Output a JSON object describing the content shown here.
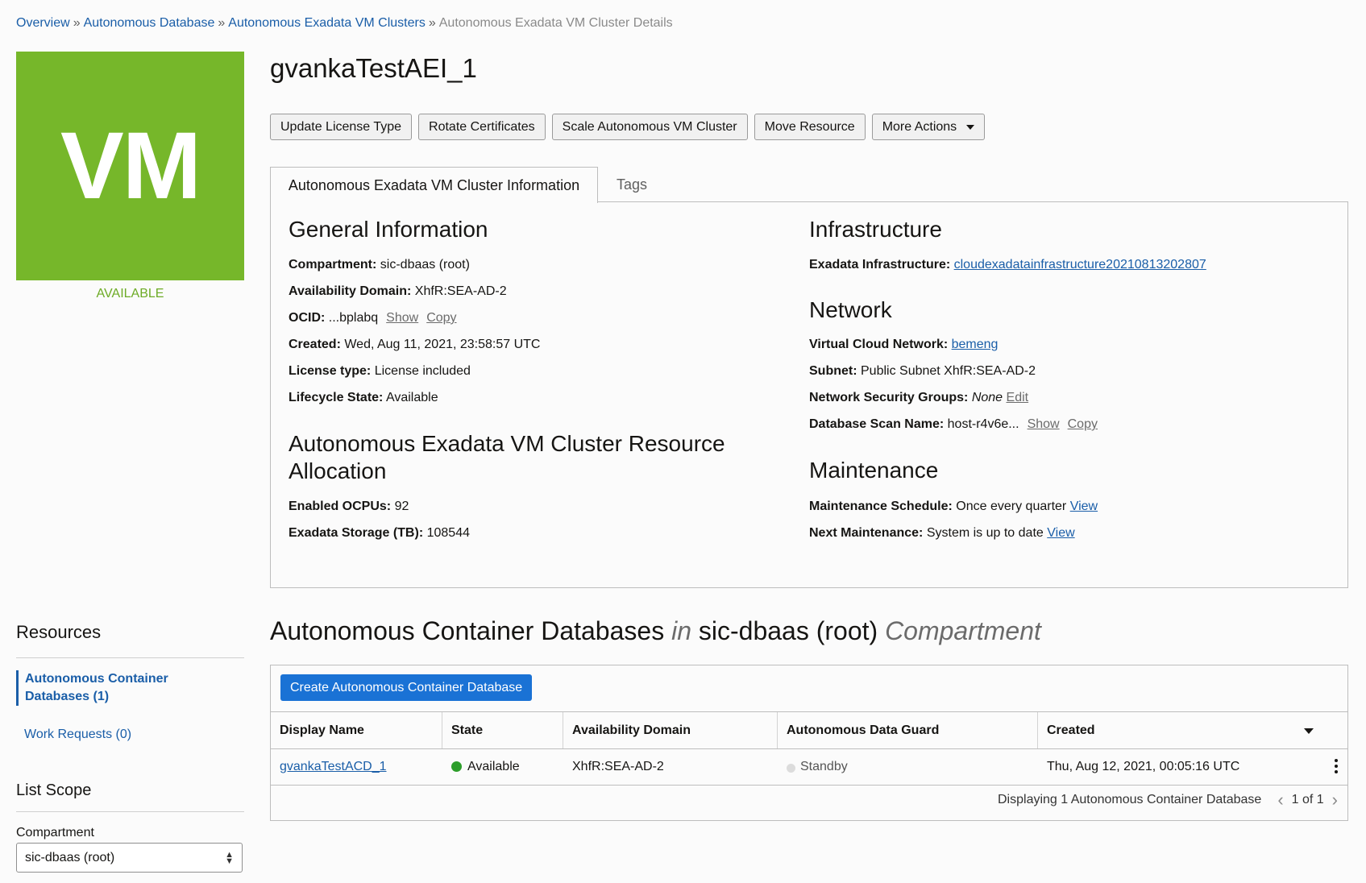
{
  "breadcrumb": {
    "items": [
      "Overview",
      "Autonomous Database",
      "Autonomous Exadata VM Clusters"
    ],
    "separator": "»",
    "current": "Autonomous Exadata VM Cluster Details"
  },
  "resource": {
    "icon_text": "VM",
    "status": "AVAILABLE",
    "title": "gvankaTestAEI_1"
  },
  "actions": {
    "update_license": "Update License Type",
    "rotate_certs": "Rotate Certificates",
    "scale": "Scale Autonomous VM Cluster",
    "move": "Move Resource",
    "more": "More Actions"
  },
  "tabs": {
    "info": "Autonomous Exadata VM Cluster Information",
    "tags": "Tags"
  },
  "general": {
    "heading": "General Information",
    "compartment_label": "Compartment:",
    "compartment": "sic-dbaas (root)",
    "ad_label": "Availability Domain:",
    "ad": "XhfR:SEA-AD-2",
    "ocid_label": "OCID:",
    "ocid": "...bplabq",
    "show": "Show",
    "copy": "Copy",
    "created_label": "Created:",
    "created": "Wed, Aug 11, 2021, 23:58:57 UTC",
    "license_label": "License type:",
    "license": "License included",
    "lifecycle_label": "Lifecycle State:",
    "lifecycle": "Available"
  },
  "allocation": {
    "heading_line1": "Autonomous Exadata VM Cluster Resource",
    "heading_line2": "Allocation",
    "ocpus_label": "Enabled OCPUs:",
    "ocpus": "92",
    "storage_label": "Exadata Storage (TB):",
    "storage": "108544"
  },
  "infrastructure": {
    "heading": "Infrastructure",
    "exa_label": "Exadata Infrastructure:",
    "exa": "cloudexadatainfrastructure20210813202807"
  },
  "network": {
    "heading": "Network",
    "vcn_label": "Virtual Cloud Network:",
    "vcn": "bemeng",
    "subnet_label": "Subnet:",
    "subnet": "Public Subnet XhfR:SEA-AD-2",
    "nsg_label": "Network Security Groups:",
    "nsg": "None",
    "edit": "Edit",
    "scan_label": "Database Scan Name:",
    "scan": "host-r4v6e...",
    "show": "Show",
    "copy": "Copy"
  },
  "maintenance": {
    "heading": "Maintenance",
    "schedule_label": "Maintenance Schedule:",
    "schedule": "Once every quarter",
    "view": "View",
    "next_label": "Next Maintenance:",
    "next": "System is up to date"
  },
  "sidebar": {
    "resources_title": "Resources",
    "acd_item": "Autonomous Container Databases (1)",
    "work_requests": "Work Requests (0)",
    "list_scope": "List Scope",
    "compartment_label": "Compartment",
    "compartment_value": "sic-dbaas (root)"
  },
  "cdb": {
    "title_part1": "Autonomous Container Databases",
    "title_in": "in",
    "title_part2": "sic-dbaas (root)",
    "title_part3": "Compartment",
    "create_button": "Create Autonomous Container Database",
    "columns": [
      "Display Name",
      "State",
      "Availability Domain",
      "Autonomous Data Guard",
      "Created"
    ],
    "row": {
      "name": "gvankaTestACD_1",
      "state": "Available",
      "ad": "XhfR:SEA-AD-2",
      "dataguard": "Standby",
      "created": "Thu, Aug 12, 2021, 00:05:16 UTC"
    },
    "footer": "Displaying 1 Autonomous Container Database",
    "pagination": "1 of 1"
  },
  "colors": {
    "accent": "#1a72d5",
    "link": "#1a5ea8",
    "vm_tile": "#76b72a",
    "available_green": "#2d9e2b"
  }
}
